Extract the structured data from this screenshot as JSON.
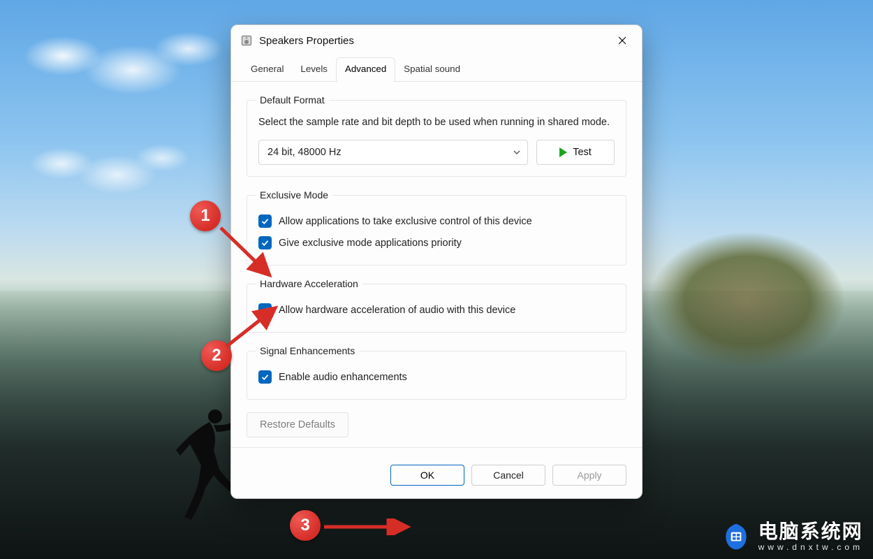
{
  "dialog": {
    "title": "Speakers Properties",
    "tabs": [
      "General",
      "Levels",
      "Advanced",
      "Spatial sound"
    ],
    "active_tab_index": 2,
    "groups": {
      "default_format": {
        "legend": "Default Format",
        "description": "Select the sample rate and bit depth to be used when running in shared mode.",
        "selected_value": "24 bit, 48000 Hz",
        "test_label": "Test"
      },
      "exclusive_mode": {
        "legend": "Exclusive Mode",
        "chk_allow": "Allow applications to take exclusive control of this device",
        "chk_priority": "Give exclusive mode applications priority"
      },
      "hw_accel": {
        "legend": "Hardware Acceleration",
        "chk_hw": "Allow hardware acceleration of audio with this device"
      },
      "signal": {
        "legend": "Signal Enhancements",
        "chk_enh": "Enable audio enhancements"
      }
    },
    "restore_label": "Restore Defaults",
    "buttons": {
      "ok": "OK",
      "cancel": "Cancel",
      "apply": "Apply"
    }
  },
  "annotations": {
    "c1": "1",
    "c2": "2",
    "c3": "3"
  },
  "watermark": {
    "line1": "电脑系统网",
    "line2": "www.dnxtw.com"
  }
}
